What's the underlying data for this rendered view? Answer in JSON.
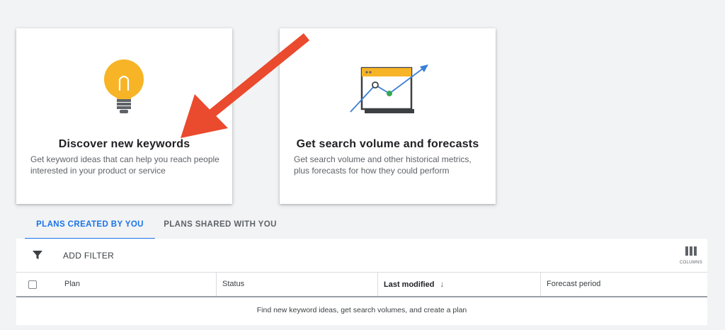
{
  "cards": [
    {
      "title": "Discover new keywords",
      "description": "Get keyword ideas that can help you reach people interested in your product or service",
      "icon": "lightbulb-icon"
    },
    {
      "title": "Get search volume and forecasts",
      "description": "Get search volume and other historical metrics, plus forecasts for how they could perform",
      "icon": "forecast-chart-icon"
    }
  ],
  "tabs": [
    {
      "label": "PLANS CREATED BY YOU",
      "active": true
    },
    {
      "label": "PLANS SHARED WITH YOU",
      "active": false
    }
  ],
  "filter_bar": {
    "add_filter_label": "ADD FILTER",
    "columns_label": "COLUMNS",
    "filter_icon": "filter-icon",
    "columns_icon": "columns-icon"
  },
  "table": {
    "columns": [
      "Plan",
      "Status",
      "Last modified",
      "Forecast period"
    ],
    "sorted_column": "Last modified",
    "sort_direction": "descending",
    "empty_message": "Find new keyword ideas, get search volumes, and create a plan"
  },
  "colors": {
    "accent": "#1a73e8",
    "bulb": "#f6b426",
    "annotation_arrow": "#ea4a2e",
    "chart_green": "#34a853"
  }
}
